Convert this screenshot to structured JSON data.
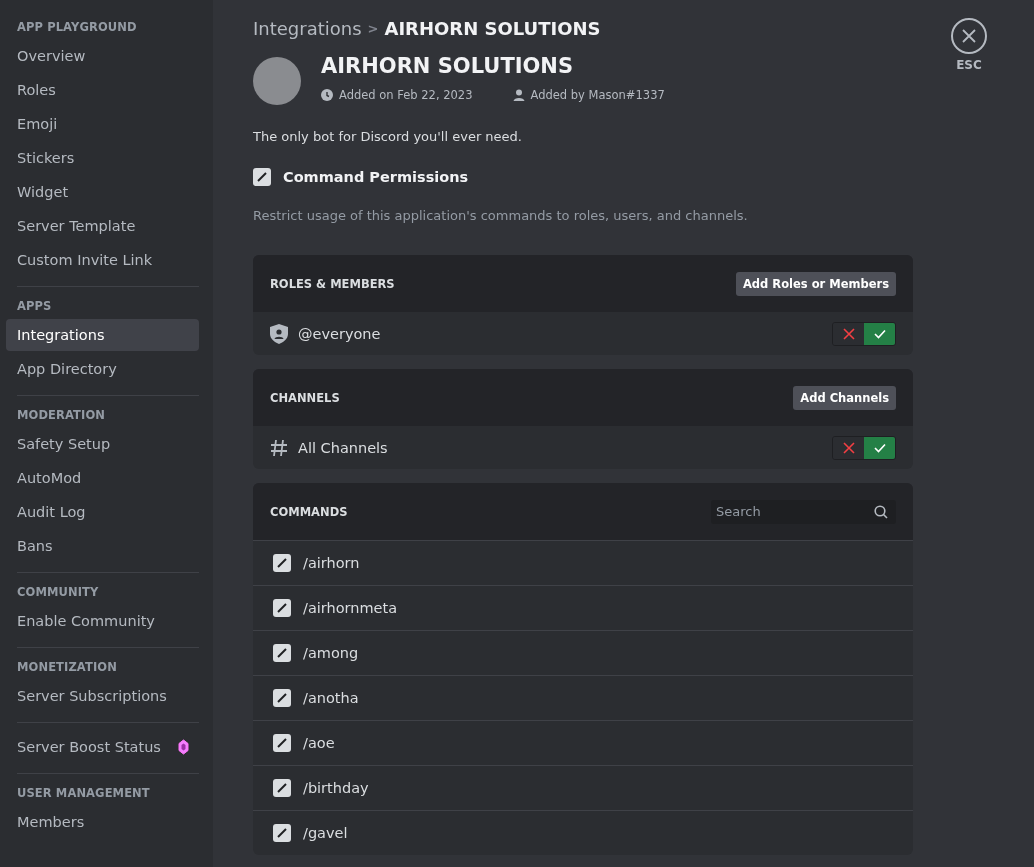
{
  "sidebar": {
    "sections": [
      {
        "heading": "APP PLAYGROUND",
        "items": [
          {
            "label": "Overview",
            "selected": false
          },
          {
            "label": "Roles",
            "selected": false
          },
          {
            "label": "Emoji",
            "selected": false
          },
          {
            "label": "Stickers",
            "selected": false
          },
          {
            "label": "Widget",
            "selected": false
          },
          {
            "label": "Server Template",
            "selected": false
          },
          {
            "label": "Custom Invite Link",
            "selected": false
          }
        ]
      },
      {
        "heading": "APPS",
        "items": [
          {
            "label": "Integrations",
            "selected": true
          },
          {
            "label": "App Directory",
            "selected": false
          }
        ]
      },
      {
        "heading": "MODERATION",
        "items": [
          {
            "label": "Safety Setup",
            "selected": false
          },
          {
            "label": "AutoMod",
            "selected": false
          },
          {
            "label": "Audit Log",
            "selected": false
          },
          {
            "label": "Bans",
            "selected": false
          }
        ]
      },
      {
        "heading": "COMMUNITY",
        "items": [
          {
            "label": "Enable Community",
            "selected": false
          }
        ]
      },
      {
        "heading": "MONETIZATION",
        "items": [
          {
            "label": "Server Subscriptions",
            "selected": false
          }
        ]
      },
      {
        "items": [
          {
            "label": "Server Boost Status",
            "selected": false,
            "badge": true
          }
        ]
      },
      {
        "heading": "USER MANAGEMENT",
        "items": [
          {
            "label": "Members",
            "selected": false
          }
        ]
      }
    ]
  },
  "breadcrumb": {
    "parent": "Integrations",
    "separator": ">",
    "current": "AIRHORN SOLUTIONS"
  },
  "app": {
    "name": "AIRHORN SOLUTIONS",
    "added_on": "Added on Feb 22, 2023",
    "added_by": "Added by Mason#1337",
    "description": "The only bot for Discord you'll ever need."
  },
  "command_permissions": {
    "title": "Command Permissions",
    "checked": true,
    "description": "Restrict usage of this application's commands to roles, users, and channels."
  },
  "panels": [
    {
      "title": "ROLES & MEMBERS",
      "button": "Add Roles or Members",
      "rows": [
        {
          "kind": "role",
          "label": "@everyone",
          "allowed": true
        }
      ]
    },
    {
      "title": "CHANNELS",
      "button": "Add Channels",
      "rows": [
        {
          "kind": "channel",
          "label": "All Channels",
          "allowed": true
        }
      ]
    }
  ],
  "commands": {
    "title": "COMMANDS",
    "search": {
      "placeholder": "Search"
    },
    "items": [
      {
        "label": "/airhorn",
        "checked": true
      },
      {
        "label": "/airhornmeta",
        "checked": true
      },
      {
        "label": "/among",
        "checked": true
      },
      {
        "label": "/anotha",
        "checked": true
      },
      {
        "label": "/aoe",
        "checked": true
      },
      {
        "label": "/birthday",
        "checked": true
      },
      {
        "label": "/gavel",
        "checked": true
      }
    ]
  },
  "close": {
    "label": "ESC"
  }
}
